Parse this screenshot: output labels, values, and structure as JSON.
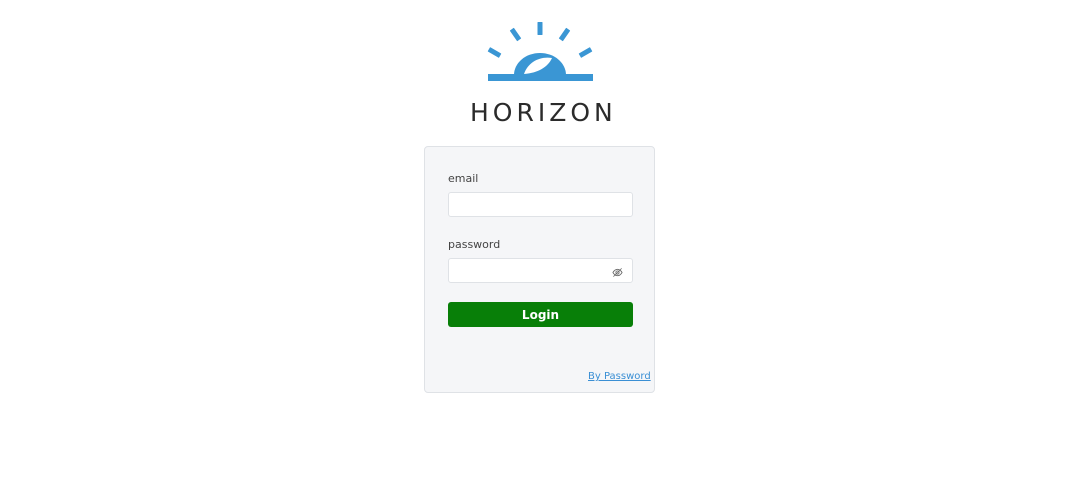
{
  "brand": {
    "name": "HORIZON",
    "logo_icon": "rising-sun-logo",
    "logo_color": "#3a96d4"
  },
  "login_form": {
    "email_label": "email",
    "email_value": "",
    "password_label": "password",
    "password_value": "",
    "password_toggle_icon": "eye-slash-icon",
    "login_button_label": "Login",
    "login_button_color": "#087f08",
    "alt_login_link": "By Password"
  }
}
